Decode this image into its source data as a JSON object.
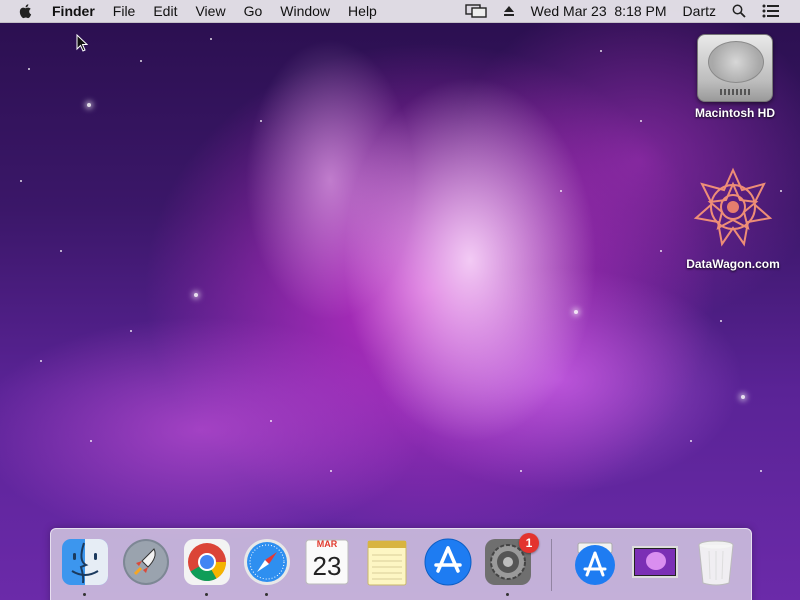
{
  "menubar": {
    "apple_icon": "apple-icon",
    "app_name": "Finder",
    "menus": [
      "File",
      "Edit",
      "View",
      "Go",
      "Window",
      "Help"
    ],
    "status": {
      "display_icon": "airplay-display-icon",
      "eject_icon": "eject-icon",
      "datetime": "Wed Mar 23  8:18 PM",
      "user": "Dartz",
      "search_icon": "spotlight-search-icon",
      "notifications_icon": "notification-center-icon"
    }
  },
  "desktop": {
    "icons": [
      {
        "label": "Macintosh HD",
        "icon": "hard-drive-icon"
      },
      {
        "label": "DataWagon.com",
        "icon": "datawagon-mandala-icon"
      }
    ]
  },
  "dock": {
    "apps": [
      {
        "name": "Finder",
        "icon": "finder-icon",
        "running": true
      },
      {
        "name": "Launchpad",
        "icon": "launchpad-rocket-icon",
        "running": false
      },
      {
        "name": "Google Chrome",
        "icon": "chrome-icon",
        "running": true
      },
      {
        "name": "Safari",
        "icon": "safari-compass-icon",
        "running": true
      },
      {
        "name": "Calendar",
        "icon": "calendar-icon",
        "running": false,
        "month": "MAR",
        "day": "23"
      },
      {
        "name": "Notes",
        "icon": "notes-icon",
        "running": false
      },
      {
        "name": "App Store",
        "icon": "app-store-icon",
        "running": false
      },
      {
        "name": "System Preferences",
        "icon": "system-preferences-gear-icon",
        "running": true,
        "badge": "1"
      }
    ],
    "others": [
      {
        "name": "App Store Downloads",
        "icon": "app-store-icon"
      },
      {
        "name": "Desktop Folder",
        "icon": "desktop-wallpaper-stack-icon"
      },
      {
        "name": "Trash",
        "icon": "trash-icon"
      }
    ]
  },
  "colors": {
    "accent_blue": "#1e7cf2",
    "badge_red": "#e3332f",
    "wallpaper_magenta": "#d63fd3"
  }
}
